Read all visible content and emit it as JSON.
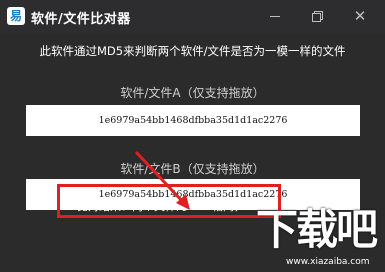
{
  "window": {
    "title": "软件/文件比对器",
    "icon_name": "app-logo-icon",
    "controls": {
      "minimize": "minimize-icon",
      "maximize": "restore-icon",
      "close": "✕"
    }
  },
  "main": {
    "description": "此软件通过MD5来判断两个软件/文件是否为一模一样的文件",
    "section_a": {
      "label": "软件/文件A（仅支持拖放）",
      "value": "1e6979a54bb1468dfbba35d1d1ac2276"
    },
    "section_b": {
      "label": "软件/文件B（仅支持拖放）",
      "value": "1e6979a54bb1468dfbba35d1d1ac2276"
    },
    "result": "比对结果：两个文件的MD5相同，"
  },
  "watermark": {
    "logo": "下载吧",
    "url": "www.xiazaiba.com"
  },
  "colors": {
    "background": "#2b2b2b",
    "titlebar": "#2d2d30",
    "highlight_red": "#e02020"
  }
}
